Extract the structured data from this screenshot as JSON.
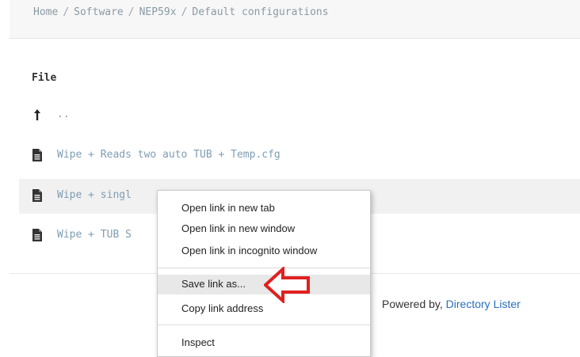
{
  "breadcrumb": {
    "items": [
      "Home",
      "Software",
      "NEP59x",
      "Default configurations"
    ],
    "separator": "/"
  },
  "listing": {
    "column_header": "File",
    "parent": {
      "icon": "up-arrow-icon",
      "label": ".."
    },
    "files": [
      {
        "icon": "file-icon",
        "label": "Wipe + Reads two auto TUB + Temp.cfg"
      },
      {
        "icon": "file-icon",
        "label": "Wipe + singl"
      },
      {
        "icon": "file-icon",
        "label": "Wipe + TUB S"
      }
    ]
  },
  "footer": {
    "prefix": "Powered by,",
    "link": "Directory Lister"
  },
  "context_menu": {
    "items": [
      "Open link in new tab",
      "Open link in new window",
      "Open link in incognito window",
      "Save link as...",
      "Copy link address",
      "Inspect"
    ],
    "highlighted": "Save link as..."
  },
  "colors": {
    "link": "#7f9db3",
    "footer_link": "#2a6fbc",
    "annotation_arrow": "#e02020",
    "menu_highlight": "#e8e8e8"
  },
  "annotation": {
    "icon": "red-arrow-icon"
  }
}
